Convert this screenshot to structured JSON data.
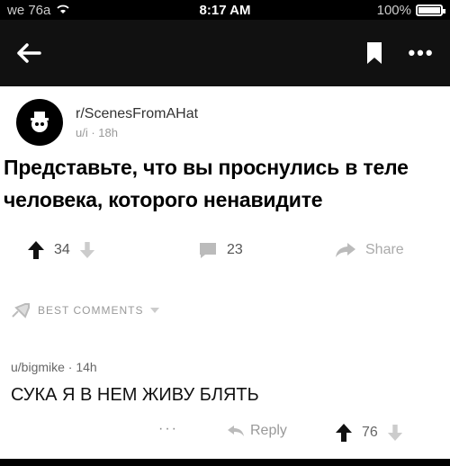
{
  "status_bar": {
    "carrier": "we 76a",
    "time": "8:17 AM",
    "battery": "100%"
  },
  "post": {
    "subreddit": "r/ScenesFromAHat",
    "submitted": "u/i                  · 18h",
    "title": "Представьте, что вы проснулись в теле человека, которого ненавидите",
    "upvotes": "34",
    "comments": "23",
    "share_label": "Share"
  },
  "comments_section": {
    "sort_label": "BEST COMMENTS"
  },
  "comment": {
    "author": "u/bigmike · 14h",
    "body": "СУКА Я В НЕМ ЖИВУ БЛЯТЬ",
    "more": "···",
    "reply_label": "Reply",
    "score": "76"
  },
  "icons": {
    "back": "back-arrow-icon",
    "bookmark": "bookmark-icon",
    "more": "more-options-icon",
    "upvote": "upvote-arrow-icon",
    "downvote": "downvote-arrow-icon",
    "comment": "comment-icon",
    "share": "share-arrow-icon",
    "sort": "rocket-icon",
    "wifi": "wifi-icon"
  },
  "colors": {
    "nav_background": "#111111",
    "text_primary": "#000000",
    "text_secondary": "#999999"
  }
}
